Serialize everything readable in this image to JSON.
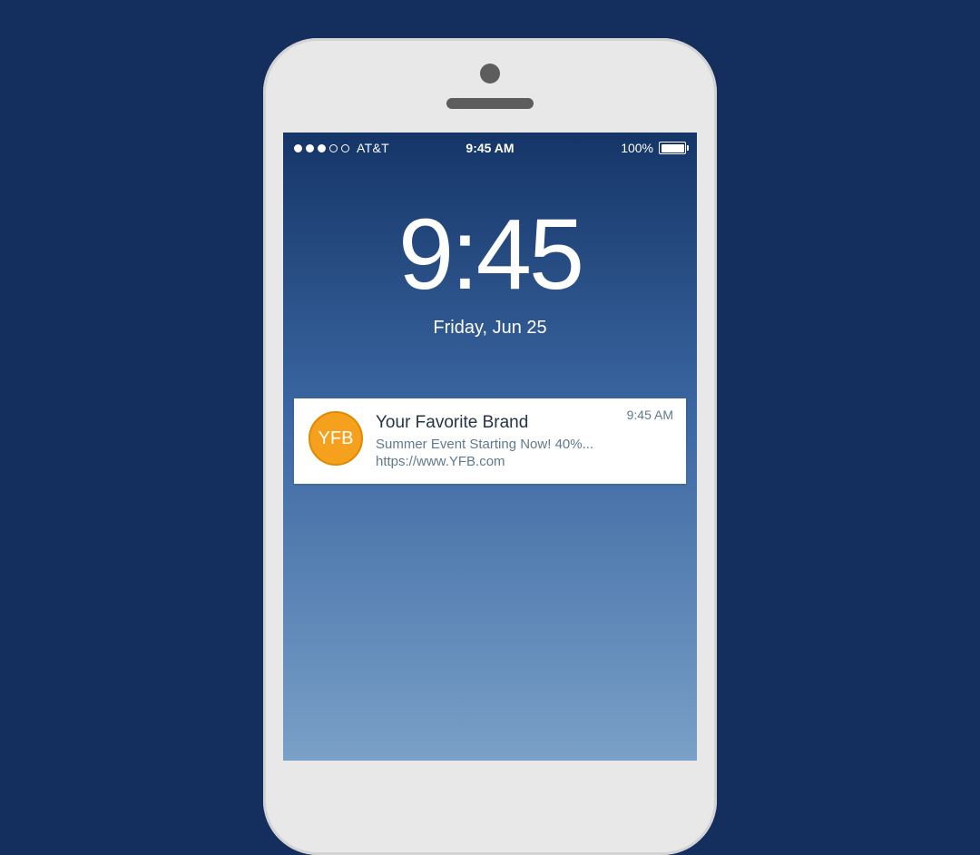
{
  "status_bar": {
    "carrier": "AT&T",
    "time": "9:45 AM",
    "battery_pct": "100%"
  },
  "lock_screen": {
    "time": "9:45",
    "date": "Friday, Jun 25"
  },
  "notification": {
    "avatar_initials": "YFB",
    "title": "Your Favorite Brand",
    "preview": "Summer Event Starting Now! 40%...",
    "link": "https://www.YFB.com",
    "timestamp": "9:45 AM"
  },
  "colors": {
    "background": "#142f5e",
    "phone_body": "#e8e8e8",
    "avatar": "#f5a11d"
  }
}
